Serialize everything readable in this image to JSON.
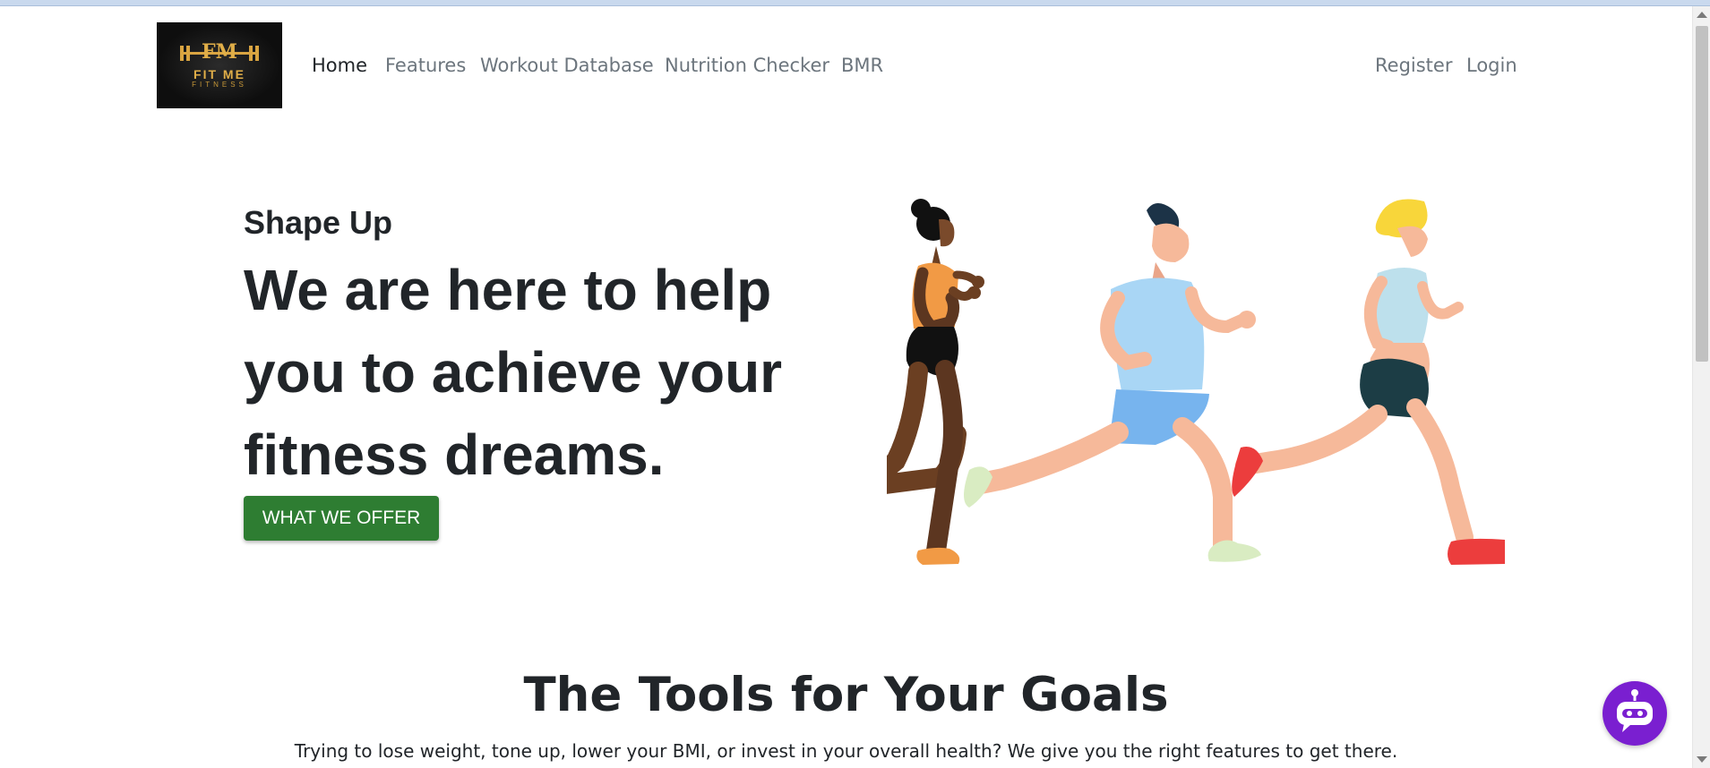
{
  "brand": {
    "logo_monogram": "FM",
    "logo_name": "FIT ME",
    "logo_tagline": "FITNESS"
  },
  "nav": {
    "home": "Home",
    "features": "Features",
    "workout_database": "Workout Database",
    "nutrition_checker": "Nutrition Checker",
    "bmr": "BMR",
    "register": "Register",
    "login": "Login"
  },
  "hero": {
    "eyebrow": "Shape Up",
    "title": "We are here to help you to achieve your fitness dreams.",
    "button_label": "WHAT WE OFFER"
  },
  "tools": {
    "title": "The Tools for Your Goals",
    "description": "Trying to lose weight, tone up, lower your BMI, or invest in your overall health? We give you the right features to get there."
  },
  "icons": {
    "chat": "robot-chat-icon",
    "illustration": "runners-illustration"
  },
  "colors": {
    "primary_button": "#2e7d32",
    "chat_button": "#7a1fd0",
    "logo_gold": "#e0ae48"
  }
}
